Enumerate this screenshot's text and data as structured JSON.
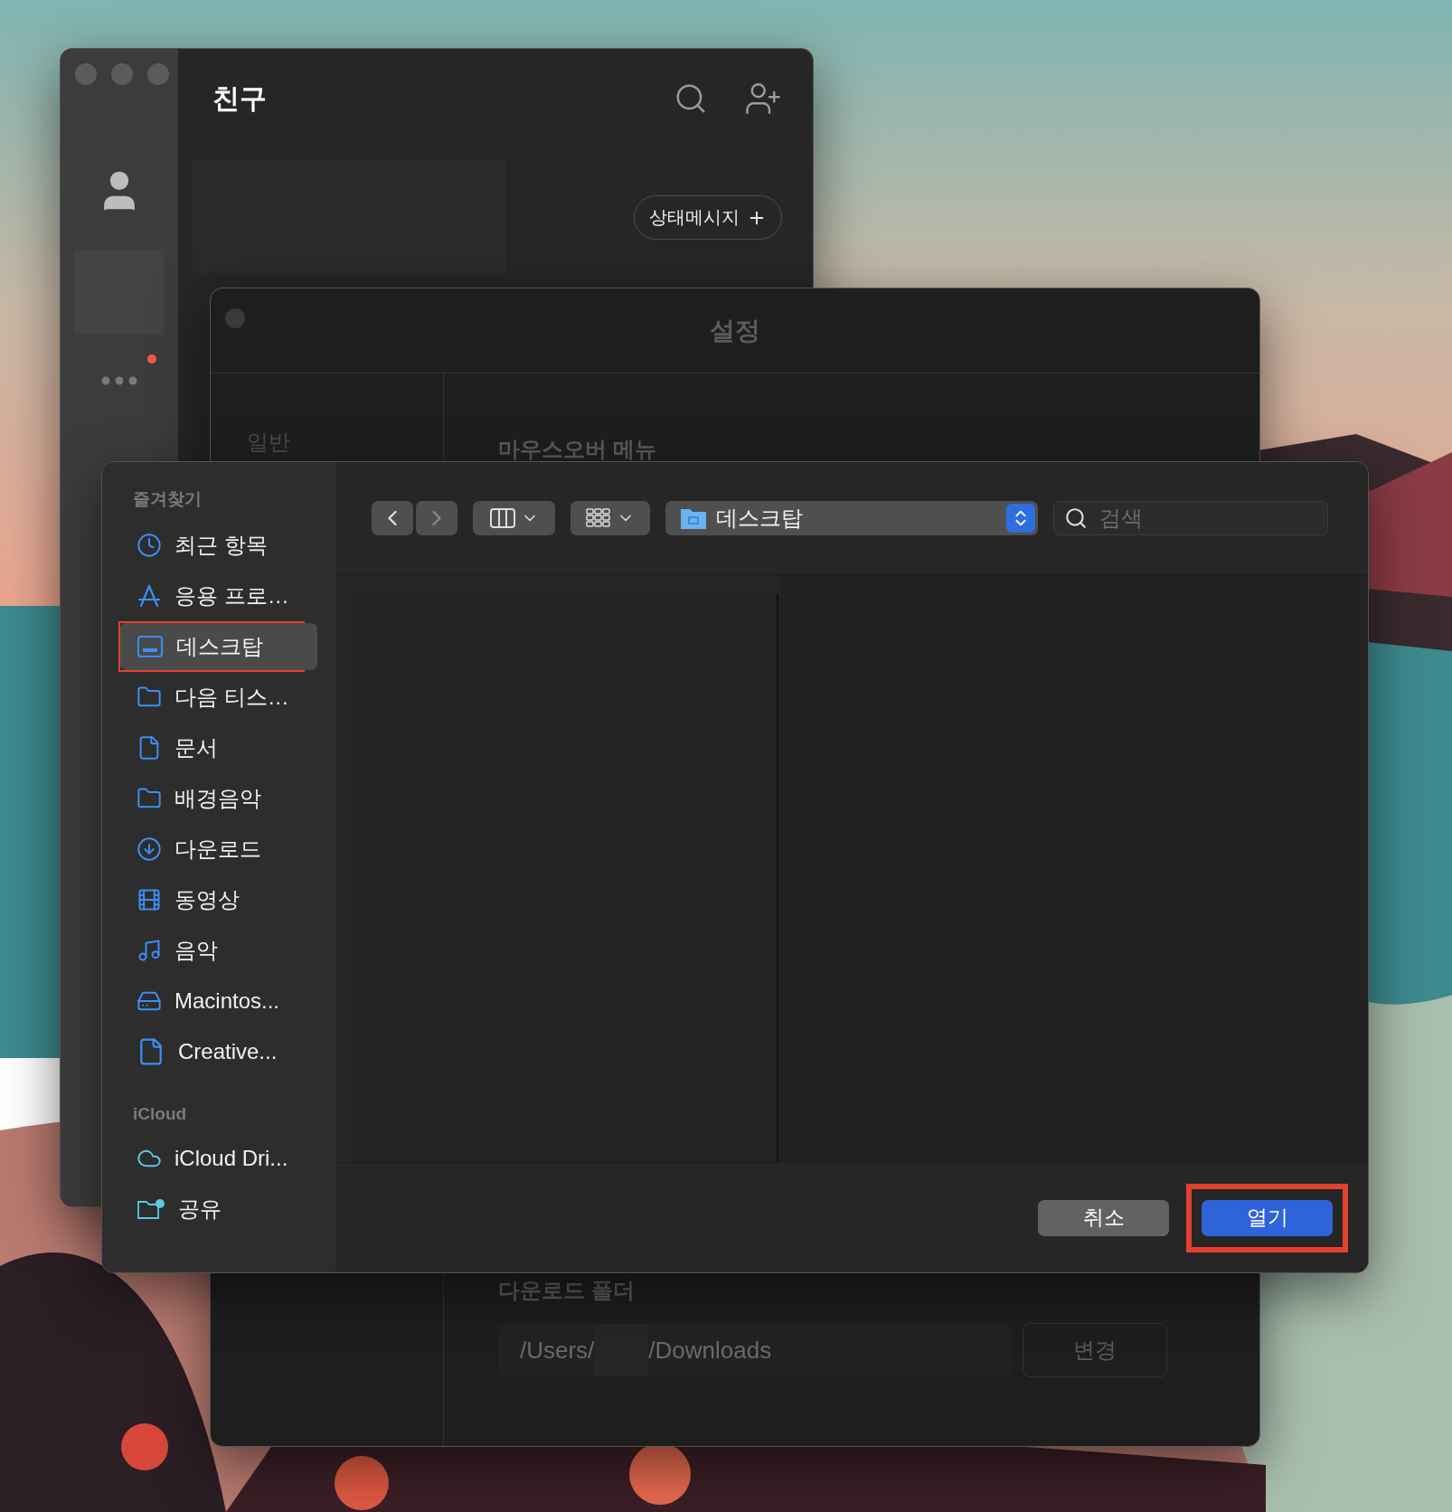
{
  "friends_window": {
    "title": "친구",
    "status_button": "상태메시지",
    "notification": true
  },
  "settings_window": {
    "title": "설정",
    "sidebar_items": [
      {
        "label": "일반"
      }
    ],
    "mouseover_heading": "마우스오버 메뉴",
    "download": {
      "heading": "다운로드 폴더",
      "path_start": "/Users/",
      "path_end": "/Downloads",
      "button": "변경"
    }
  },
  "open_dialog": {
    "toolbar": {
      "location": "데스크탑",
      "search": {
        "placeholder": "검색"
      }
    },
    "sidebar": [
      {
        "heading": "즐겨찾기",
        "items": [
          {
            "label": "최근 항목",
            "kind": "clock",
            "selected": false,
            "annotated": false
          },
          {
            "label": "응용 프로…",
            "kind": "apps",
            "selected": false,
            "annotated": false
          },
          {
            "label": "데스크탑",
            "kind": "desktop",
            "selected": true,
            "annotated": true
          },
          {
            "label": "다음 티스…",
            "kind": "folder",
            "selected": false,
            "annotated": false
          },
          {
            "label": "문서",
            "kind": "document",
            "selected": false,
            "annotated": false
          },
          {
            "label": "배경음악",
            "kind": "folder",
            "selected": false,
            "annotated": false
          },
          {
            "label": "다운로드",
            "kind": "download",
            "selected": false,
            "annotated": false
          },
          {
            "label": "동영상",
            "kind": "movie",
            "selected": false,
            "annotated": false
          },
          {
            "label": "음악",
            "kind": "music",
            "selected": false,
            "annotated": false
          },
          {
            "label": "Macintos...",
            "kind": "disk",
            "selected": false,
            "annotated": false
          },
          {
            "label": "Creative...",
            "kind": "file",
            "selected": false,
            "annotated": false
          }
        ]
      },
      {
        "heading": "iCloud",
        "items": [
          {
            "label": "iCloud Dri...",
            "kind": "cloud",
            "selected": false,
            "annotated": false
          },
          {
            "label": "공유",
            "kind": "shared",
            "selected": false,
            "annotated": false
          }
        ]
      }
    ],
    "buttons": [
      {
        "label": "취소",
        "kind": "cancel",
        "annotated": false
      },
      {
        "label": "열기",
        "kind": "default",
        "annotated": true
      }
    ]
  }
}
